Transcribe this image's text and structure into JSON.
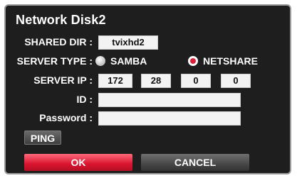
{
  "dialog": {
    "title": "Network Disk2"
  },
  "form": {
    "shared_dir_label": "SHARED DIR :",
    "shared_dir_value": "tvixhd2",
    "server_type_label": "SERVER TYPE :",
    "server_type_options": [
      {
        "label": "SAMBA",
        "selected": false
      },
      {
        "label": "NETSHARE",
        "selected": true
      }
    ],
    "server_ip_label": "SERVER IP :",
    "server_ip": [
      "172",
      "28",
      "0",
      "0"
    ],
    "id_label": "ID :",
    "id_value": "",
    "password_label": "Password :",
    "password_value": ""
  },
  "buttons": {
    "ping": "PING",
    "ok": "OK",
    "cancel": "CANCEL"
  },
  "colors": {
    "background": "#1e1e1e",
    "accent_red": "#d9142e",
    "field_bg": "#f3f3f3"
  }
}
